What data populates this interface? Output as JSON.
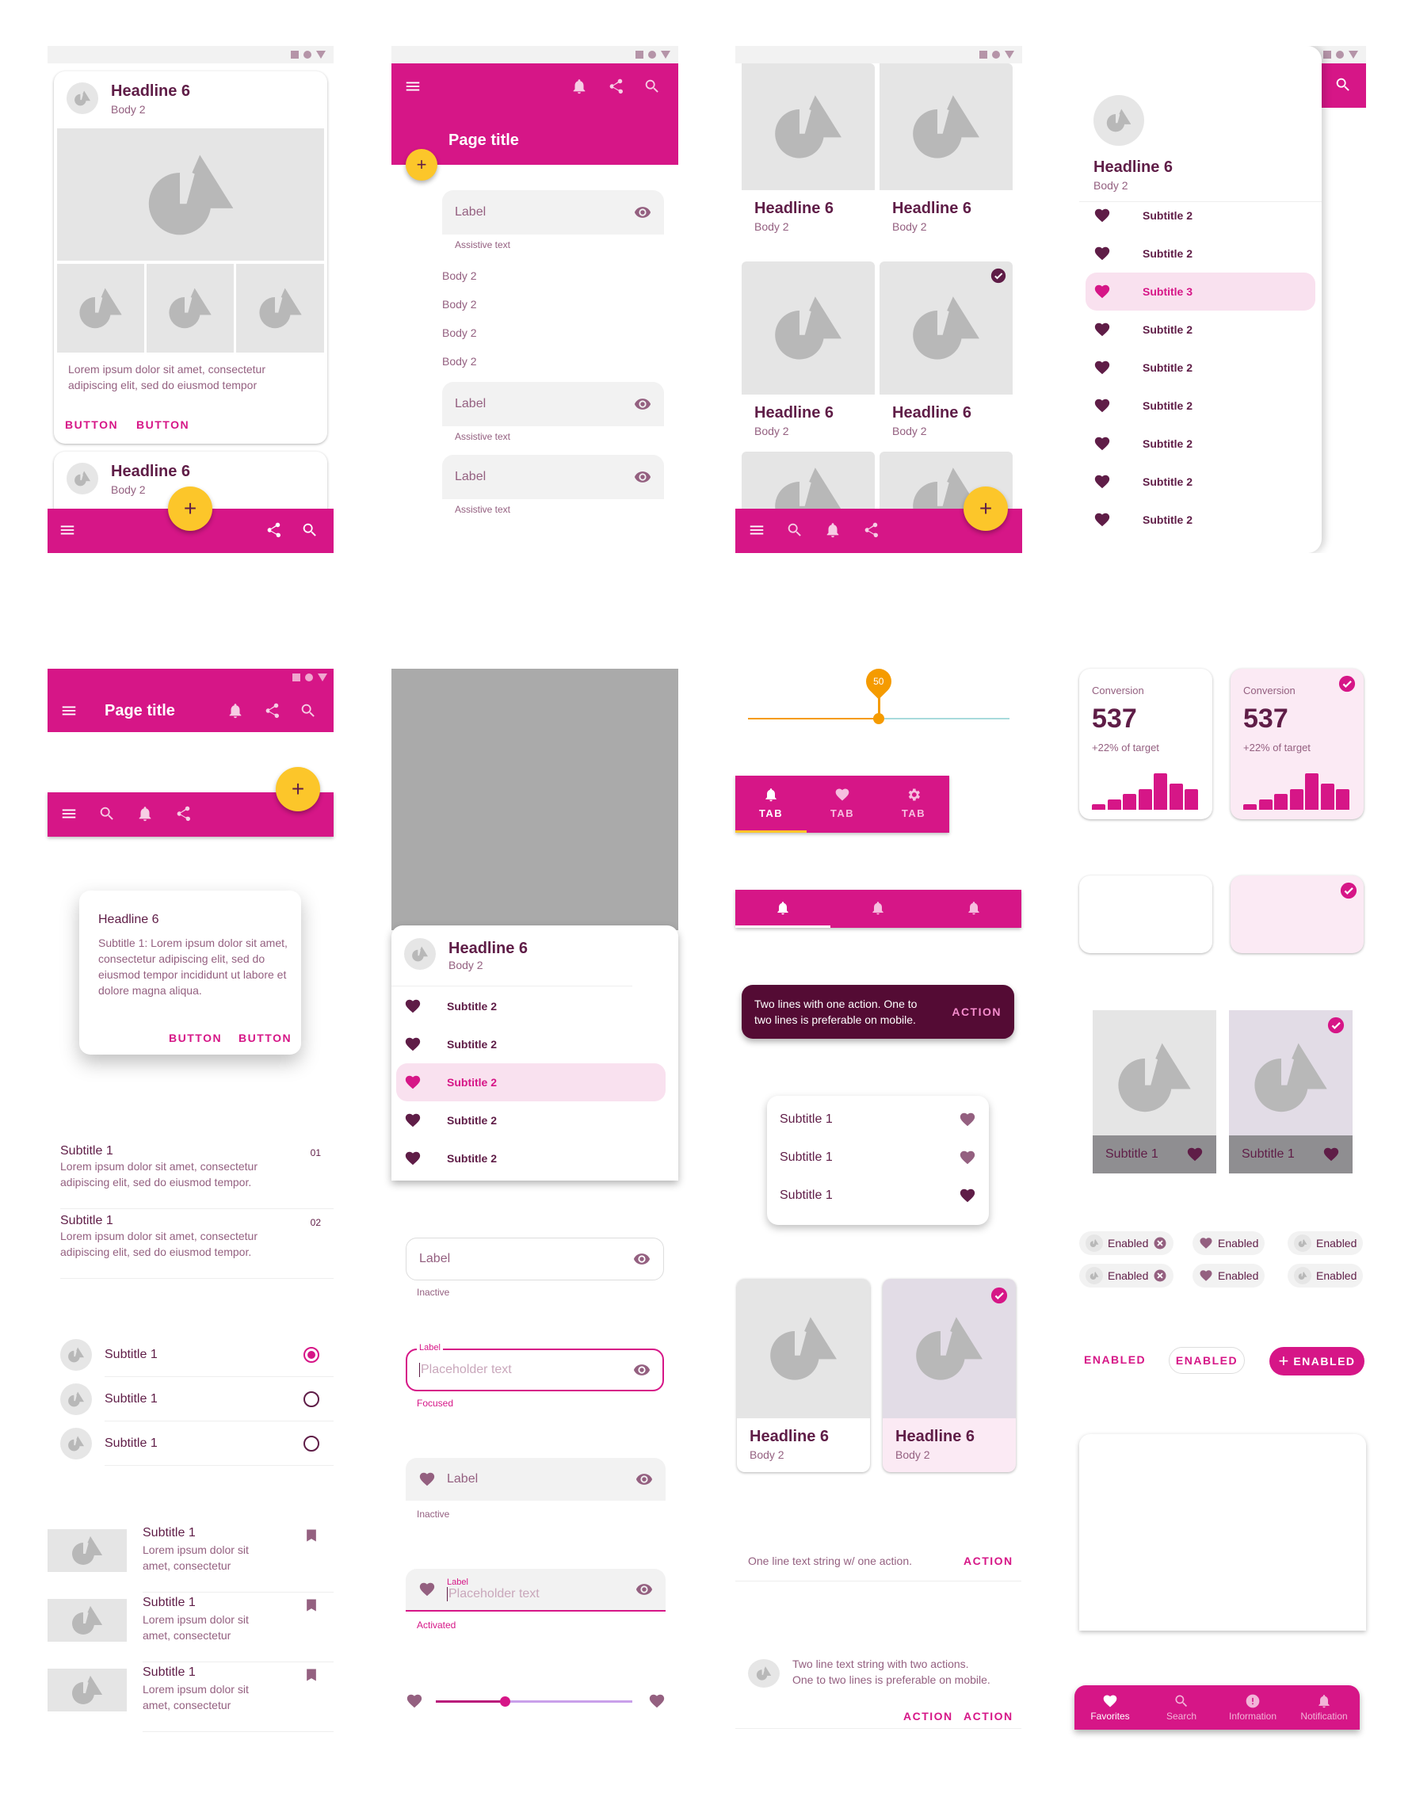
{
  "colors": {
    "primary": "#d61687",
    "secondary": "#fcc62a",
    "on_surface": "#5f1d47",
    "muted": "#946080",
    "selected_bg": "#f9e1ef",
    "snackbar_bg": "#540b34"
  },
  "screen1": {
    "card1": {
      "headline": "Headline 6",
      "body": "Body 2",
      "text": "Lorem ipsum dolor sit amet, consectetur adipiscing elit, sed do eiusmod tempor",
      "buttons": [
        "BUTTON",
        "BUTTON"
      ]
    },
    "card2": {
      "headline": "Headline 6",
      "body": "Body 2"
    },
    "bottom_bar": {
      "icons": [
        "menu-icon",
        "share-icon",
        "search-icon"
      ],
      "fab": "+"
    }
  },
  "screen2": {
    "top_bar": {
      "title": "Page title",
      "icons": [
        "menu-icon",
        "bell-icon",
        "share-icon",
        "search-icon"
      ],
      "fab": "+"
    },
    "fields": [
      {
        "label": "Label",
        "helper": "Assistive text"
      },
      {
        "label": "Label",
        "helper": "Assistive text"
      },
      {
        "label": "Label",
        "helper": "Assistive text"
      }
    ],
    "body_items": [
      "Body 2",
      "Body 2",
      "Body 2",
      "Body 2"
    ]
  },
  "screen3": {
    "tiles": [
      {
        "headline": "Headline 6",
        "body": "Body 2",
        "selected": false
      },
      {
        "headline": "Headline 6",
        "body": "Body 2",
        "selected": false
      },
      {
        "headline": "Headline 6",
        "body": "Body 2",
        "selected": false
      },
      {
        "headline": "Headline 6",
        "body": "Body 2",
        "selected": true
      }
    ],
    "bottom_bar": {
      "icons": [
        "menu-icon",
        "search-icon",
        "bell-icon",
        "share-icon"
      ],
      "fab": "+"
    }
  },
  "screen4": {
    "drawer": {
      "headline": "Headline 6",
      "body": "Body 2",
      "items": [
        {
          "label": "Subtitle 2",
          "active": false
        },
        {
          "label": "Subtitle 2",
          "active": false
        },
        {
          "label": "Subtitle 3",
          "active": true
        },
        {
          "label": "Subtitle 2",
          "active": false
        },
        {
          "label": "Subtitle 2",
          "active": false
        },
        {
          "label": "Subtitle 2",
          "active": false
        },
        {
          "label": "Subtitle 2",
          "active": false
        },
        {
          "label": "Subtitle 2",
          "active": false
        },
        {
          "label": "Subtitle 2",
          "active": false
        }
      ]
    }
  },
  "col1": {
    "top_bar": {
      "title": "Page title"
    },
    "bottom_bar": {
      "fab": "+"
    },
    "dialog": {
      "title": "Headline 6",
      "text": "Subtitle 1: Lorem ipsum dolor sit amet, consectetur adipiscing elit, sed do eiusmod tempor incididunt ut labore et dolore magna aliqua.",
      "buttons": [
        "BUTTON",
        "BUTTON"
      ]
    },
    "two_line_list": [
      {
        "title": "Subtitle 1",
        "text": "Lorem ipsum dolor sit amet, consectetur adipiscing elit, sed do eiusmod tempor.",
        "meta": "01"
      },
      {
        "title": "Subtitle 1",
        "text": "Lorem ipsum dolor sit amet, consectetur adipiscing elit, sed do eiusmod tempor.",
        "meta": "02"
      }
    ],
    "radio_list": [
      {
        "label": "Subtitle 1",
        "checked": true
      },
      {
        "label": "Subtitle 1",
        "checked": false
      },
      {
        "label": "Subtitle 1",
        "checked": false
      }
    ],
    "image_list": [
      {
        "title": "Subtitle 1",
        "text": "Lorem ipsum dolor sit amet, consectetur"
      },
      {
        "title": "Subtitle 1",
        "text": "Lorem ipsum dolor sit amet, consectetur"
      },
      {
        "title": "Subtitle 1",
        "text": "Lorem ipsum dolor sit amet, consectetur"
      }
    ]
  },
  "col2": {
    "sheet": {
      "headline": "Headline 6",
      "body": "Body 2",
      "items": [
        {
          "label": "Subtitle 2",
          "active": false
        },
        {
          "label": "Subtitle 2",
          "active": false
        },
        {
          "label": "Subtitle 2",
          "active": true
        },
        {
          "label": "Subtitle 2",
          "active": false
        },
        {
          "label": "Subtitle 2",
          "active": false
        }
      ]
    },
    "outlined_inactive": {
      "label": "Label",
      "helper": "Inactive"
    },
    "outlined_focused": {
      "label": "Label",
      "placeholder": "Placeholder text",
      "helper": "Focused"
    },
    "filled_inactive": {
      "label": "Label",
      "helper": "Inactive"
    },
    "filled_activated": {
      "label": "Label",
      "placeholder": "Placeholder text",
      "helper": "Activated"
    },
    "slider": {
      "value_fraction": 0.35
    }
  },
  "col3": {
    "discrete_slider": {
      "value": "50",
      "fraction": 0.5
    },
    "tabs": [
      {
        "label": "TAB",
        "icon": "bell-icon",
        "active": true
      },
      {
        "label": "TAB",
        "icon": "heart-icon",
        "active": false
      },
      {
        "label": "TAB",
        "icon": "gear-icon",
        "active": false
      }
    ],
    "icon_tabs": [
      {
        "icon": "bell-icon",
        "active": true
      },
      {
        "icon": "bell-icon",
        "active": false
      },
      {
        "icon": "bell-icon",
        "active": false
      }
    ],
    "snackbar": {
      "text": "Two lines with one action. One to two lines is preferable on mobile.",
      "action": "ACTION"
    },
    "menu": [
      {
        "label": "Subtitle 1"
      },
      {
        "label": "Subtitle 1"
      },
      {
        "label": "Subtitle 1"
      }
    ],
    "cards": [
      {
        "headline": "Headline 6",
        "body": "Body 2",
        "selected": false
      },
      {
        "headline": "Headline 6",
        "body": "Body 2",
        "selected": true
      }
    ],
    "banner1": {
      "text": "One line text string w/ one action.",
      "action": "ACTION"
    },
    "banner2": {
      "text": "Two line text string with two actions. One to two lines is preferable on mobile.",
      "actions": [
        "ACTION",
        "ACTION"
      ]
    }
  },
  "col4": {
    "stat_cards": [
      {
        "label": "Conversion",
        "value": "537",
        "delta": "+22% of target",
        "selected": false
      },
      {
        "label": "Conversion",
        "value": "537",
        "delta": "+22% of target",
        "selected": true
      }
    ],
    "chart_data": {
      "type": "bar",
      "values": [
        1,
        2,
        3,
        4,
        7,
        5,
        4
      ],
      "ylim": [
        0,
        7
      ]
    },
    "image_tiles": [
      {
        "label": "Subtitle 1",
        "selected": false
      },
      {
        "label": "Subtitle 1",
        "selected": true
      }
    ],
    "chips": [
      {
        "label": "Enabled",
        "lead": "avatar",
        "close": true
      },
      {
        "label": "Enabled",
        "lead": "heart",
        "close": false
      },
      {
        "label": "Enabled",
        "lead": "avatar",
        "close": false
      },
      {
        "label": "Enabled",
        "lead": "avatar",
        "close": true
      },
      {
        "label": "Enabled",
        "lead": "heart",
        "close": false
      },
      {
        "label": "Enabled",
        "lead": "avatar",
        "close": false
      }
    ],
    "buttons": {
      "text": "ENABLED",
      "outlined": "ENABLED",
      "contained": "ENABLED"
    },
    "bottom_nav": [
      {
        "label": "Favorites",
        "icon": "heart-icon",
        "active": true
      },
      {
        "label": "Search",
        "icon": "search-icon",
        "active": false
      },
      {
        "label": "Information",
        "icon": "info-icon",
        "active": false
      },
      {
        "label": "Notification",
        "icon": "bell-icon",
        "active": false
      }
    ]
  }
}
